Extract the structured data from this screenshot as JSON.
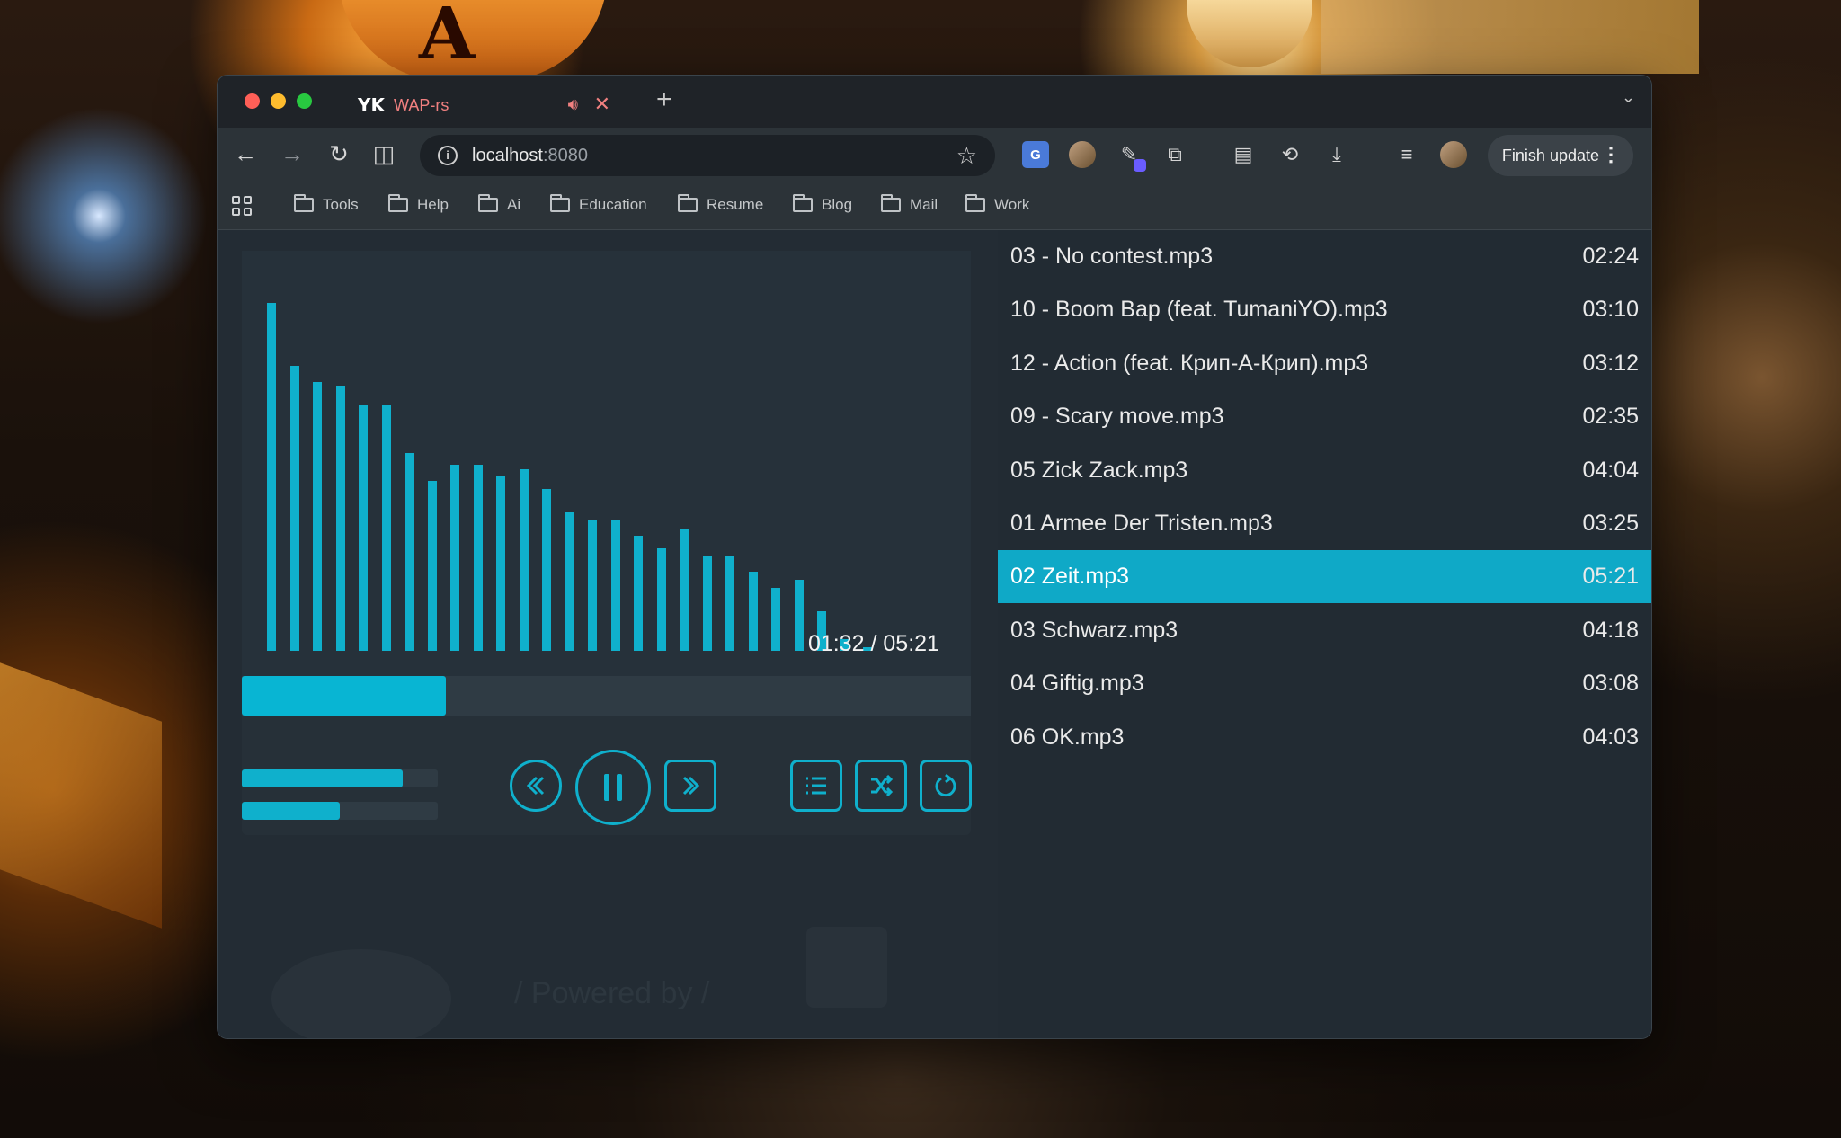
{
  "browser": {
    "tab": {
      "favicon": "YK",
      "title": "WAP-rs"
    },
    "url": {
      "host": "localhost",
      "port": ":8080"
    },
    "finish_update": "Finish update"
  },
  "bookmarks": [
    "Tools",
    "Help",
    "Ai",
    "Education",
    "Resume",
    "Blog",
    "Mail",
    "Work"
  ],
  "player": {
    "time": "01:32 / 05:21",
    "progress": 0.28,
    "volume": [
      0.82,
      0.5
    ],
    "visualizer_levels": [
      0.88,
      0.72,
      0.68,
      0.67,
      0.62,
      0.62,
      0.5,
      0.43,
      0.47,
      0.47,
      0.44,
      0.46,
      0.41,
      0.35,
      0.33,
      0.33,
      0.29,
      0.26,
      0.31,
      0.24,
      0.24,
      0.2,
      0.16,
      0.18,
      0.1,
      0.03,
      0.01
    ],
    "powered_by": "/ Powered by /"
  },
  "playlist": [
    {
      "name": "03 - No contest.mp3",
      "duration": "02:24"
    },
    {
      "name": "10 - Boom Bap (feat. TumaniYO).mp3",
      "duration": "03:10"
    },
    {
      "name": "12 - Action (feat. Крип-А-Крип).mp3",
      "duration": "03:12"
    },
    {
      "name": "09 - Scary move.mp3",
      "duration": "02:35"
    },
    {
      "name": "05 Zick Zack.mp3",
      "duration": "04:04"
    },
    {
      "name": "01 Armee Der Tristen.mp3",
      "duration": "03:25"
    },
    {
      "name": "02 Zeit.mp3",
      "duration": "05:21"
    },
    {
      "name": "03 Schwarz.mp3",
      "duration": "04:18"
    },
    {
      "name": "04 Giftig.mp3",
      "duration": "03:08"
    },
    {
      "name": "06 OK.mp3",
      "duration": "04:03"
    }
  ],
  "active_index": 6
}
